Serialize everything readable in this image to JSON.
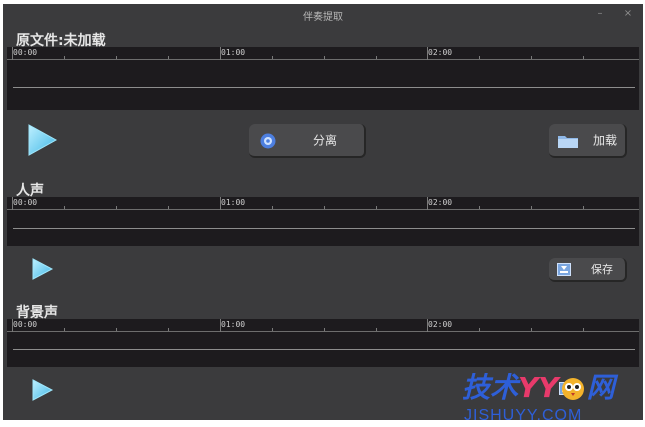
{
  "window": {
    "title": "伴奏提取",
    "minimize_glyph": "–",
    "close_glyph": "×"
  },
  "sections": {
    "original": {
      "label": "原文件:未加载"
    },
    "vocal": {
      "label": "人声"
    },
    "background": {
      "label": "背景声"
    }
  },
  "timeline": {
    "ticks": [
      "00:00",
      "01:00",
      "02:00"
    ]
  },
  "buttons": {
    "separate": "分离",
    "load": "加载",
    "save": "保存"
  },
  "icons": {
    "play": "play-icon",
    "separate": "gear-icon",
    "load": "folder-icon",
    "save": "save-icon",
    "minimize": "minimize-icon",
    "close": "close-icon"
  },
  "watermark": {
    "brand": "技术",
    "brand_yy": "YY",
    "brand_net": "网",
    "domain": "JISHUYY.COM"
  },
  "colors": {
    "window_bg": "#3b3b3d",
    "track_bg": "#1d1b1e",
    "accent_cyan": "#6ad4f2",
    "watermark_blue": "#2e5fd8"
  }
}
